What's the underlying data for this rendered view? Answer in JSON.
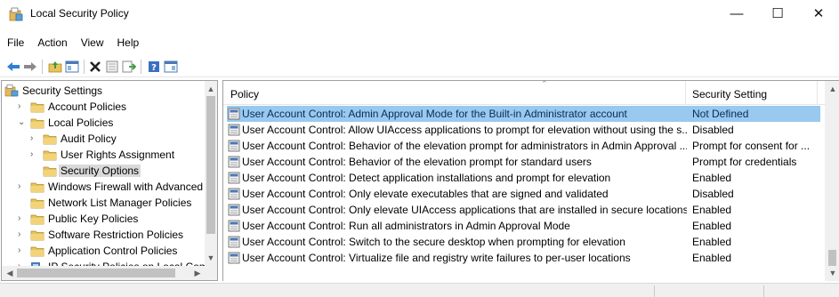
{
  "window": {
    "title": "Local Security Policy",
    "minimize_glyph": "—",
    "maximize_glyph": "☐",
    "close_glyph": "✕"
  },
  "menu": {
    "items": [
      "File",
      "Action",
      "View",
      "Help"
    ]
  },
  "toolbar": {
    "icons": [
      "back-arrow-icon",
      "forward-arrow-icon",
      "up-folder-icon",
      "show-hide-console-tree-icon",
      "delete-icon",
      "properties-icon",
      "export-list-icon",
      "help-icon",
      "show-hide-action-pane-icon"
    ]
  },
  "tree": {
    "items": [
      {
        "label": "Security Settings",
        "level": 0,
        "expander": "",
        "icon": "security-settings-icon"
      },
      {
        "label": "Account Policies",
        "level": 1,
        "expander": "›",
        "icon": "folder-icon"
      },
      {
        "label": "Local Policies",
        "level": 1,
        "expander": "⌄",
        "icon": "folder-icon"
      },
      {
        "label": "Audit Policy",
        "level": 2,
        "expander": "›",
        "icon": "folder-icon"
      },
      {
        "label": "User Rights Assignment",
        "level": 2,
        "expander": "›",
        "icon": "folder-icon"
      },
      {
        "label": "Security Options",
        "level": 2,
        "expander": "",
        "icon": "folder-icon",
        "selected": true
      },
      {
        "label": "Windows Firewall with Advanced S",
        "level": 1,
        "expander": "›",
        "icon": "folder-icon"
      },
      {
        "label": "Network List Manager Policies",
        "level": 1,
        "expander": "",
        "icon": "folder-icon"
      },
      {
        "label": "Public Key Policies",
        "level": 1,
        "expander": "›",
        "icon": "folder-icon"
      },
      {
        "label": "Software Restriction Policies",
        "level": 1,
        "expander": "›",
        "icon": "folder-icon"
      },
      {
        "label": "Application Control Policies",
        "level": 1,
        "expander": "›",
        "icon": "folder-icon"
      },
      {
        "label": "IP Security Policies on Local Comp",
        "level": 1,
        "expander": "›",
        "icon": "ip-security-icon"
      }
    ]
  },
  "list": {
    "columns": [
      "Policy",
      "Security Setting"
    ],
    "rows": [
      {
        "policy": "User Account Control: Admin Approval Mode for the Built-in Administrator account",
        "setting": "Not Defined",
        "selected": true
      },
      {
        "policy": "User Account Control: Allow UIAccess applications to prompt for elevation without using the s...",
        "setting": "Disabled"
      },
      {
        "policy": "User Account Control: Behavior of the elevation prompt for administrators in Admin Approval ...",
        "setting": "Prompt for consent for ..."
      },
      {
        "policy": "User Account Control: Behavior of the elevation prompt for standard users",
        "setting": "Prompt for credentials"
      },
      {
        "policy": "User Account Control: Detect application installations and prompt for elevation",
        "setting": "Enabled"
      },
      {
        "policy": "User Account Control: Only elevate executables that are signed and validated",
        "setting": "Disabled"
      },
      {
        "policy": "User Account Control: Only elevate UIAccess applications that are installed in secure locations",
        "setting": "Enabled"
      },
      {
        "policy": "User Account Control: Run all administrators in Admin Approval Mode",
        "setting": "Enabled"
      },
      {
        "policy": "User Account Control: Switch to the secure desktop when prompting for elevation",
        "setting": "Enabled"
      },
      {
        "policy": "User Account Control: Virtualize file and registry write failures to per-user locations",
        "setting": "Enabled"
      }
    ]
  },
  "colors": {
    "selection": "#99c9ef",
    "folder": "#e8c25a",
    "tree_selection": "#d9d9d9"
  }
}
